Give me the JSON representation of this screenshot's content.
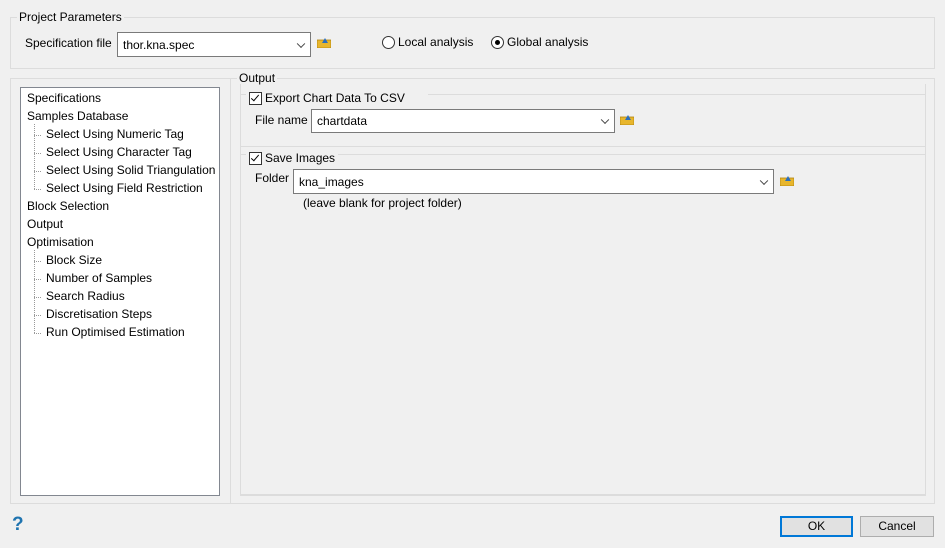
{
  "project": {
    "title": "Project Parameters",
    "spec_label": "Specification file",
    "spec_value": "thor.kna.spec",
    "local_label": "Local analysis",
    "global_label": "Global analysis",
    "selected": "global"
  },
  "tree": {
    "items": [
      {
        "label": "Specifications",
        "indent": 0
      },
      {
        "label": "Samples Database",
        "indent": 0
      },
      {
        "label": "Select Using Numeric Tag",
        "indent": 1
      },
      {
        "label": "Select Using Character Tag",
        "indent": 1
      },
      {
        "label": "Select Using Solid Triangulation",
        "indent": 1
      },
      {
        "label": "Select Using Field Restriction",
        "indent": 1
      },
      {
        "label": "Block Selection",
        "indent": 0
      },
      {
        "label": "Output",
        "indent": 0
      },
      {
        "label": "Optimisation",
        "indent": 0
      },
      {
        "label": "Block Size",
        "indent": 1
      },
      {
        "label": "Number of Samples",
        "indent": 1
      },
      {
        "label": "Search Radius",
        "indent": 1
      },
      {
        "label": "Discretisation Steps",
        "indent": 1
      },
      {
        "label": "Run Optimised Estimation",
        "indent": 1
      }
    ]
  },
  "output": {
    "title": "Output",
    "export": {
      "label": "Export Chart Data To CSV",
      "checked": true,
      "file_label": "File name",
      "file_value": "chartdata"
    },
    "images": {
      "label": "Save Images",
      "checked": true,
      "folder_label": "Folder",
      "folder_value": "kna_images",
      "hint": "(leave blank for project folder)"
    }
  },
  "footer": {
    "help": "?",
    "ok": "OK",
    "cancel": "Cancel"
  }
}
